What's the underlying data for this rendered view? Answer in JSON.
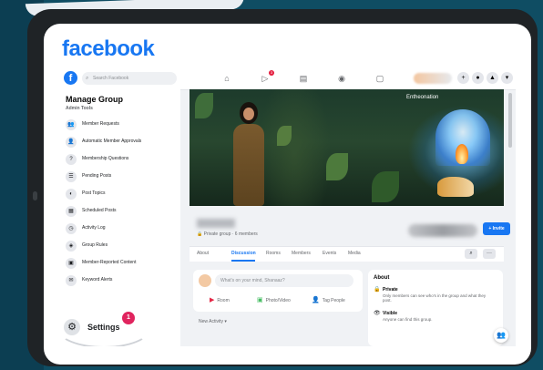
{
  "brand": {
    "logo_text": "facebook",
    "color": "#1877f2"
  },
  "topnav": {
    "search_placeholder": "Search Facebook",
    "nav_badge": "3",
    "icons": [
      "home-icon",
      "watch-icon",
      "marketplace-icon",
      "groups-icon",
      "gaming-icon"
    ],
    "right_buttons": [
      "+",
      "●",
      "▲",
      "▾"
    ]
  },
  "sidebar": {
    "title": "Manage Group",
    "subtitle": "Admin Tools",
    "items": [
      {
        "label": "Member Requests",
        "icon": "👥"
      },
      {
        "label": "Automatic Member Approvals",
        "icon": "👤"
      },
      {
        "label": "Membership Questions",
        "icon": "?"
      },
      {
        "label": "Pending Posts",
        "icon": "☰"
      },
      {
        "label": "Post Topics",
        "icon": "◐"
      },
      {
        "label": "Scheduled Posts",
        "icon": "▦"
      },
      {
        "label": "Activity Log",
        "icon": "◷"
      },
      {
        "label": "Group Rules",
        "icon": "◈"
      },
      {
        "label": "Member-Reported Content",
        "icon": "▣"
      },
      {
        "label": "Keyword Alerts",
        "icon": "✉"
      }
    ],
    "settings_label": "Settings",
    "settings_badge": "1"
  },
  "cover": {
    "tag": "Entheonation"
  },
  "group": {
    "meta": "🔒 Private group · 6 members",
    "invite_label": "+ Invite"
  },
  "tabs": {
    "items": [
      "About",
      "Discussion",
      "Rooms",
      "Members",
      "Events",
      "Media"
    ],
    "active": "Discussion",
    "search_icon": "⌕",
    "more_icon": "···"
  },
  "composer": {
    "placeholder": "What's on your mind, Shanaaz?",
    "actions": [
      {
        "label": "Room",
        "icon": "▶",
        "color": "#e42645"
      },
      {
        "label": "Photo/Video",
        "icon": "▣",
        "color": "#45bd62"
      },
      {
        "label": "Tag People",
        "icon": "👤",
        "color": "#1877f2"
      }
    ],
    "new_activity": "New Activity ▾"
  },
  "about": {
    "heading": "About",
    "private_title": "Private",
    "private_desc": "Only members can see who's in the group and what they post.",
    "visible_title": "Visible",
    "visible_desc": "Anyone can find this group."
  }
}
